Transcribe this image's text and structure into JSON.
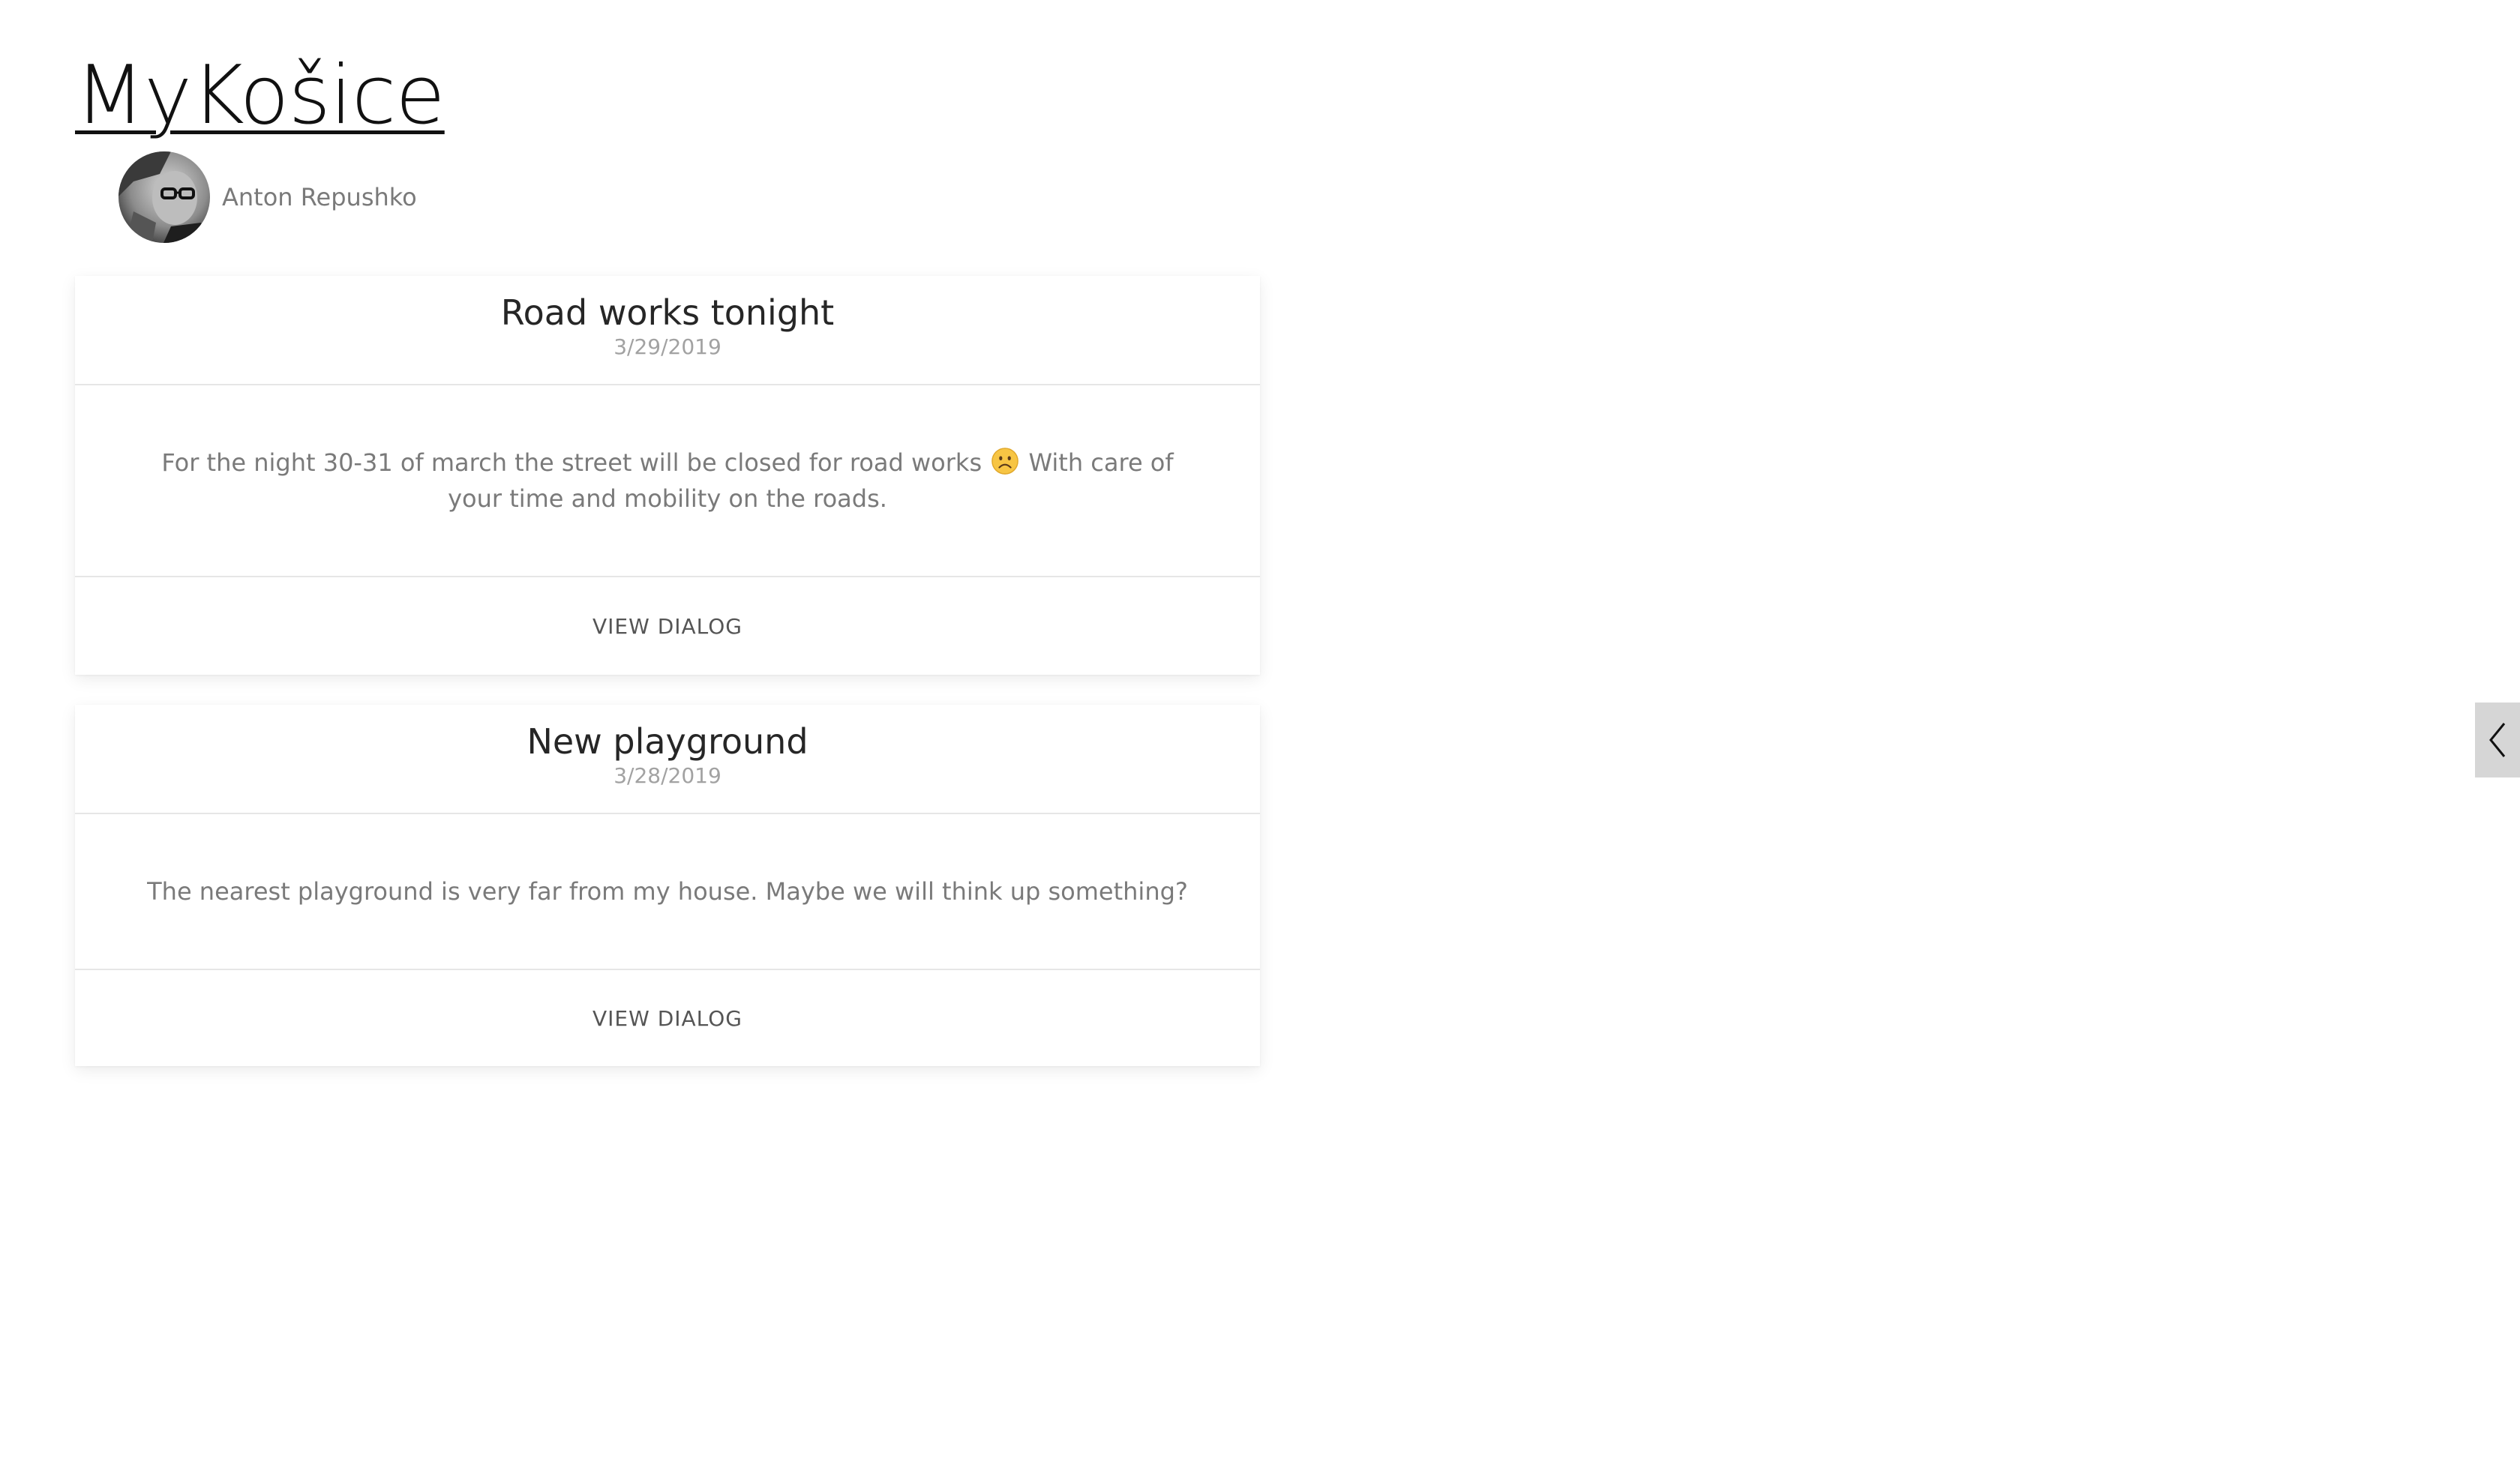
{
  "site": {
    "title": "MyKošice"
  },
  "author": {
    "name": "Anton Repushko"
  },
  "posts": [
    {
      "title": "Road works tonight",
      "date": "3/29/2019",
      "text_before_emoji": "For the night 30-31 of march the street will be closed for road works",
      "emoji": "frowning-face",
      "text_after_emoji": "With care of your time and mobility on the roads.",
      "action_label": "VIEW DIALOG"
    },
    {
      "title": "New playground",
      "date": "3/28/2019",
      "text": "The nearest playground is very far from my house. Maybe we will think up something?",
      "action_label": "VIEW DIALOG"
    }
  ],
  "sidebar_toggle": {
    "icon": "chevron-left-icon"
  },
  "colors": {
    "title_text": "#111111",
    "muted_text": "#7a7a7a",
    "date_text": "#a2a2a2",
    "divider": "#e6e6e6",
    "toggle_bg": "#d6d6d6"
  }
}
